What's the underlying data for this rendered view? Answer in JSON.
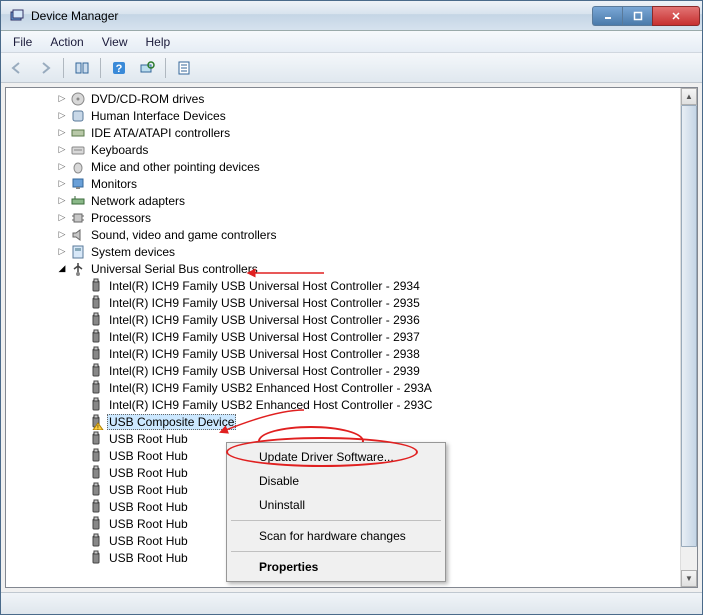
{
  "titlebar": {
    "title": "Device Manager"
  },
  "menubar": {
    "file": "File",
    "action": "Action",
    "view": "View",
    "help": "Help"
  },
  "tree": {
    "categories": {
      "dvd": "DVD/CD-ROM drives",
      "hid": "Human Interface Devices",
      "ide": "IDE ATA/ATAPI controllers",
      "keyboards": "Keyboards",
      "mice": "Mice and other pointing devices",
      "monitors": "Monitors",
      "network": "Network adapters",
      "processors": "Processors",
      "sound": "Sound, video and game controllers",
      "system": "System devices",
      "usb": "Universal Serial Bus controllers"
    },
    "usb_children": [
      "Intel(R) ICH9 Family USB Universal Host Controller - 2934",
      "Intel(R) ICH9 Family USB Universal Host Controller - 2935",
      "Intel(R) ICH9 Family USB Universal Host Controller - 2936",
      "Intel(R) ICH9 Family USB Universal Host Controller - 2937",
      "Intel(R) ICH9 Family USB Universal Host Controller - 2938",
      "Intel(R) ICH9 Family USB Universal Host Controller - 2939",
      "Intel(R) ICH9 Family USB2 Enhanced Host Controller - 293A",
      "Intel(R) ICH9 Family USB2 Enhanced Host Controller - 293C",
      "USB Composite Device",
      "USB Root Hub",
      "USB Root Hub",
      "USB Root Hub",
      "USB Root Hub",
      "USB Root Hub",
      "USB Root Hub",
      "USB Root Hub",
      "USB Root Hub"
    ]
  },
  "contextmenu": {
    "update": "Update Driver Software...",
    "disable": "Disable",
    "uninstall": "Uninstall",
    "scan": "Scan for hardware changes",
    "properties": "Properties"
  }
}
